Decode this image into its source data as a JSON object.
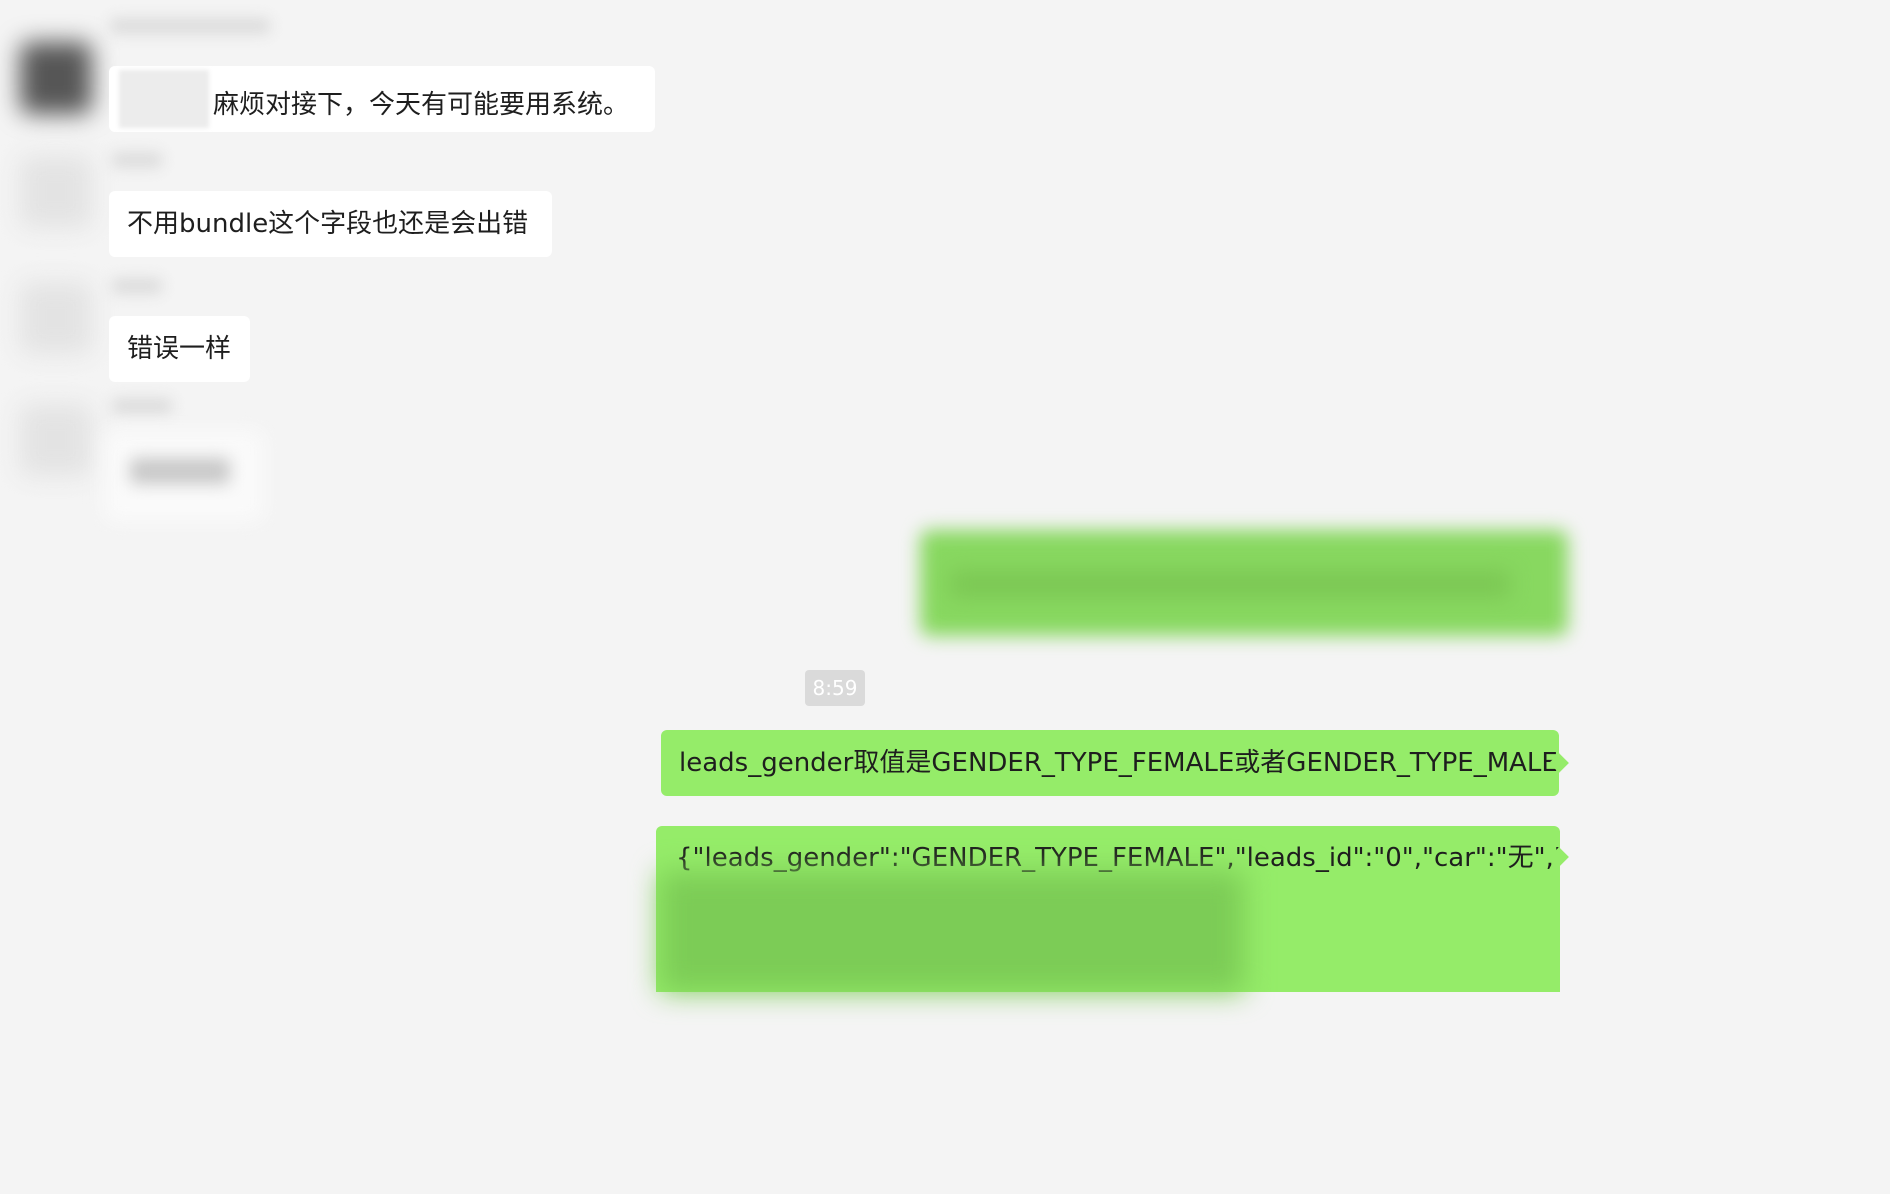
{
  "colors": {
    "background": "#f4f4f4",
    "incoming_bubble": "#ffffff",
    "outgoing_bubble": "#95ec69",
    "timestamp_bg": "#dadada",
    "timestamp_text": "#ffffff"
  },
  "messages": {
    "msg1": {
      "text": "麻烦对接下，今天有可能要用系统。"
    },
    "msg2": {
      "text": "不用bundle这个字段也还是会出错"
    },
    "msg3": {
      "text": "错误一样"
    },
    "timestamp": "8:59",
    "msg4": {
      "text": "leads_gender取值是GENDER_TYPE_FEMALE或者GENDER_TYPE_MALE"
    },
    "msg5": {
      "text": "{\"leads_gender\":\"GENDER_TYPE_FEMALE\",\"leads_id\":\"0\",\"car\":\"无\",\"lo"
    }
  }
}
